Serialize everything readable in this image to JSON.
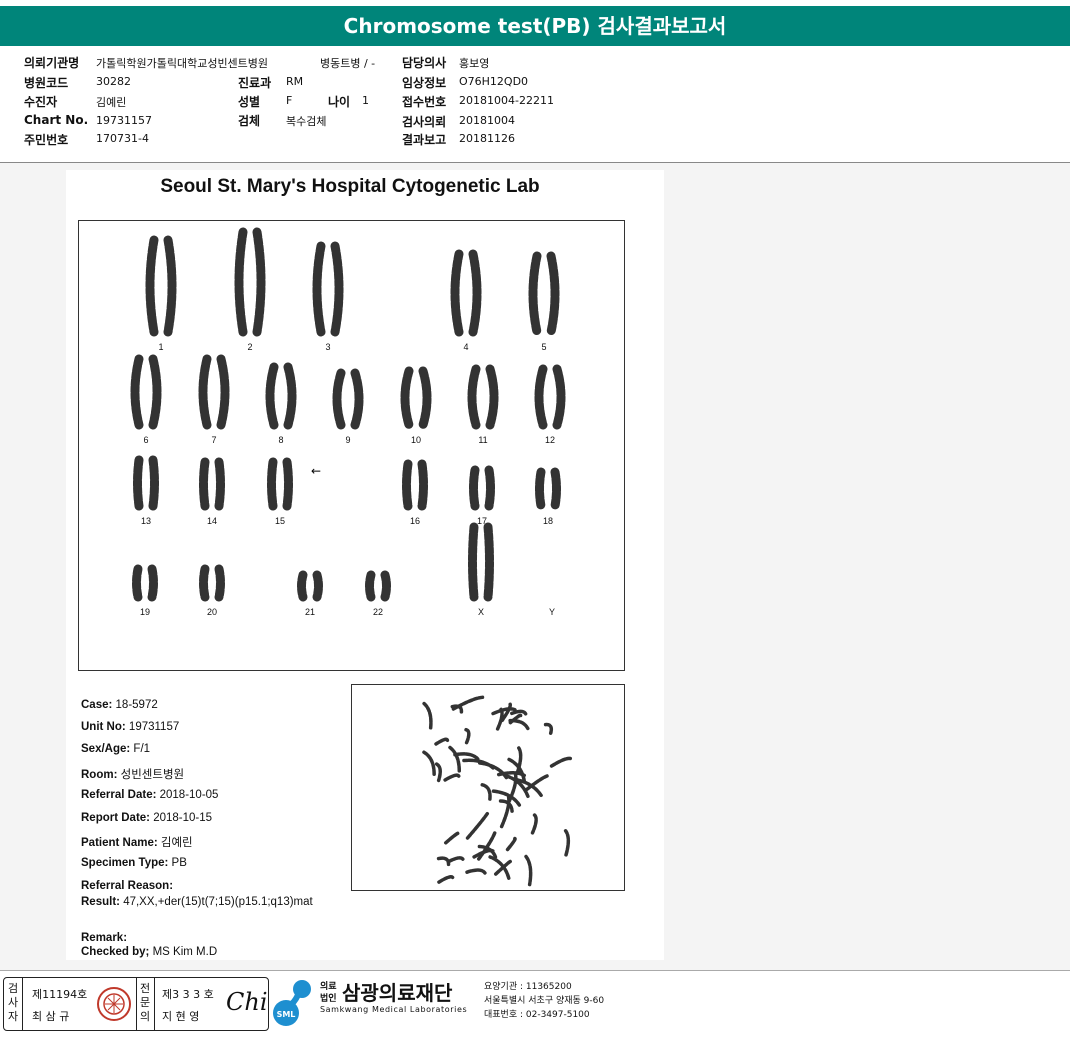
{
  "header": {
    "title": "Chromosome test(PB) 검사결과보고서"
  },
  "info": {
    "institution_label": "의뢰기관명",
    "institution": "가톨릭학원가톨릭대학교성빈센트병원",
    "ward": "병동트병 / -",
    "hospital_code_label": "병원코드",
    "hospital_code": "30282",
    "dept_label": "진료과",
    "dept": "RM",
    "patient_label": "수진자",
    "patient": "김예린",
    "sex_label": "성별",
    "sex": "F",
    "age_label": "나이",
    "age": "1",
    "chart_label": "Chart No.",
    "chart": "19731157",
    "specimen_label": "검체",
    "specimen": "복수검체",
    "resident_label": "주민번호",
    "resident": "170731-4",
    "doctor_label": "담당의사",
    "doctor": "홍보영",
    "clinical_label": "임상정보",
    "clinical": "O76H12QD0",
    "receipt_label": "접수번호",
    "receipt": "20181004-22211",
    "request_label": "검사의뢰",
    "request": "20181004",
    "result_date_label": "결과보고",
    "result_date": "20181126"
  },
  "report": {
    "lab_title": "Seoul St. Mary's Hospital Cytogenetic Lab",
    "chromosome_labels": [
      "1",
      "2",
      "3",
      "4",
      "5",
      "6",
      "7",
      "8",
      "9",
      "10",
      "11",
      "12",
      "13",
      "14",
      "15",
      "16",
      "17",
      "18",
      "19",
      "20",
      "21",
      "22",
      "X",
      "Y"
    ],
    "fields": [
      {
        "label": "Case:",
        "value": "18-5972"
      },
      {
        "label": "Unit No:",
        "value": "19731157"
      },
      {
        "label": "Sex/Age:",
        "value": "F/1"
      },
      {
        "label": "Room:",
        "value": "성빈센트병원"
      },
      {
        "label": "Referral Date:",
        "value": "2018-10-05"
      },
      {
        "label": "Report Date:",
        "value": "2018-10-15"
      },
      {
        "label": "Patient Name:",
        "value": "김예린"
      },
      {
        "label": "Specimen Type:",
        "value": "PB"
      },
      {
        "label": "Referral Reason:",
        "value": ""
      },
      {
        "label": "Result:",
        "value": "47,XX,+der(15)t(7;15)(p15.1;q13)mat"
      },
      {
        "label": "Remark:",
        "value": ""
      },
      {
        "label": "Checked by;",
        "value": "MS Kim  M.D"
      }
    ]
  },
  "footer": {
    "examiner_vertical": "검사자",
    "examiner_no": "제11194호",
    "examiner_name": "최 삼 규",
    "specialist_vertical": "전문의",
    "specialist_no": "제3 3 3 호",
    "specialist_name": "지 현 영",
    "signature": "Chi",
    "logo_abbr": "SML",
    "corp_small_1": "의료",
    "corp_small_2": "법인",
    "org_name_ko": "삼광의료재단",
    "org_name_en": "Samkwang Medical Laboratories",
    "care_code": "요양기관 : 11365200",
    "address": "서울특별시 서초구 양재동 9-60",
    "phone": "대표번호 : 02-3497-5100"
  }
}
